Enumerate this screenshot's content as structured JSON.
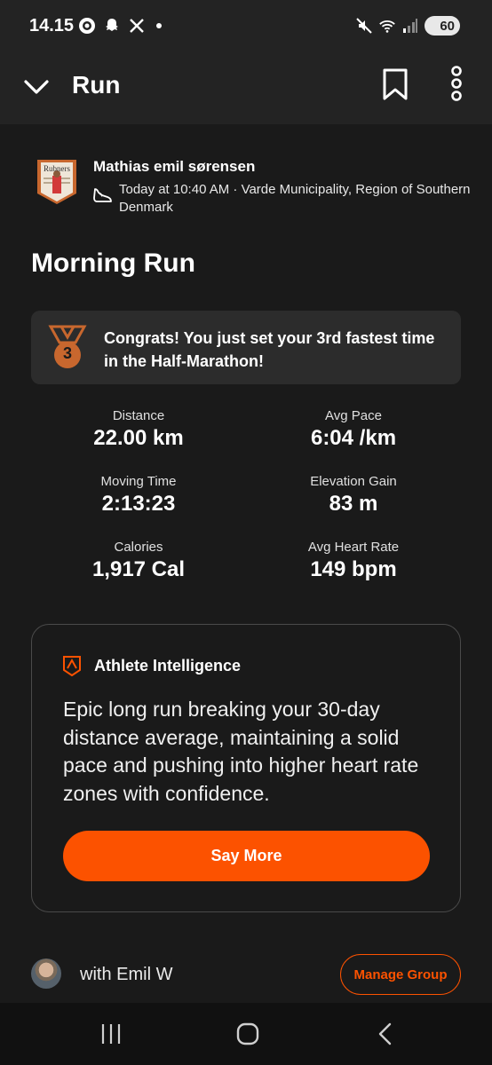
{
  "status_bar": {
    "time": "14.15",
    "battery": "60",
    "icons_left": [
      "threads-icon",
      "snapchat-icon",
      "x-icon",
      "notification-dot"
    ],
    "icons_right": [
      "mute-icon",
      "wifi-icon",
      "signal-icon",
      "battery-icon"
    ]
  },
  "header": {
    "title": "Run",
    "icons": [
      "chevron-down-icon",
      "bookmark-icon",
      "more-vertical-icon"
    ]
  },
  "author": {
    "name": "Mathias emil sørensen",
    "meta": "Today at 10:40 AM · Varde Municipality, Region of Southern Denmark",
    "badge_text": "Rubners"
  },
  "activity": {
    "title": "Morning Run"
  },
  "achievement": {
    "medal_rank": "3",
    "text": "Congrats! You just set your 3rd fastest time in the Half-Marathon!"
  },
  "stats": [
    {
      "label": "Distance",
      "value": "22.00 km"
    },
    {
      "label": "Avg Pace",
      "value": "6:04 /km"
    },
    {
      "label": "Moving Time",
      "value": "2:13:23"
    },
    {
      "label": "Elevation Gain",
      "value": "83 m"
    },
    {
      "label": "Calories",
      "value": "1,917 Cal"
    },
    {
      "label": "Avg Heart Rate",
      "value": "149 bpm"
    }
  ],
  "athlete_intelligence": {
    "title": "Athlete Intelligence",
    "summary": "Epic long run breaking your 30-day distance average, maintaining a solid pace and pushing into higher heart rate zones with confidence.",
    "button_label": "Say More"
  },
  "group": {
    "text": "with Emil W",
    "button_label": "Manage Group"
  },
  "colors": {
    "accent": "#fc5200",
    "background": "#1a1a1a",
    "card": "#2c2c2c",
    "header": "#232323",
    "medal": "#c8672e"
  }
}
